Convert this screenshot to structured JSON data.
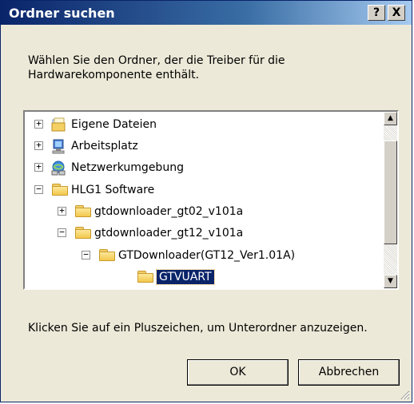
{
  "window": {
    "title": "Ordner suchen",
    "help_label": "?",
    "close_label": "X"
  },
  "instruction": "Wählen Sie den Ordner, der die Treiber für die Hardwarekomponente enthält.",
  "tree": {
    "items": [
      {
        "label": "Eigene Dateien",
        "icon": "my-documents-icon",
        "expander": "+"
      },
      {
        "label": "Arbeitsplatz",
        "icon": "my-computer-icon",
        "expander": "+"
      },
      {
        "label": "Netzwerkumgebung",
        "icon": "network-places-icon",
        "expander": "+"
      },
      {
        "label": "HLG1 Software",
        "icon": "folder-icon",
        "expander": "−"
      },
      {
        "label": "gtdownloader_gt02_v101a",
        "icon": "folder-icon",
        "expander": "+"
      },
      {
        "label": "gtdownloader_gt12_v101a",
        "icon": "folder-icon",
        "expander": "−"
      },
      {
        "label": "GTDownloader(GT12_Ver1.01A)",
        "icon": "folder-icon",
        "expander": "−"
      },
      {
        "label": "GTVUART",
        "icon": "folder-open-icon",
        "selected": true
      }
    ],
    "scroll_up_glyph": "▲",
    "scroll_down_glyph": "▼"
  },
  "hint": "Klicken Sie auf ein Pluszeichen, um Unterordner anzuzeigen.",
  "buttons": {
    "ok_label": "OK",
    "cancel_label": "Abbrechen"
  },
  "colors": {
    "titlebar": "#0a246a",
    "selection": "#0a246a",
    "dialog_bg": "#ece9d8"
  }
}
